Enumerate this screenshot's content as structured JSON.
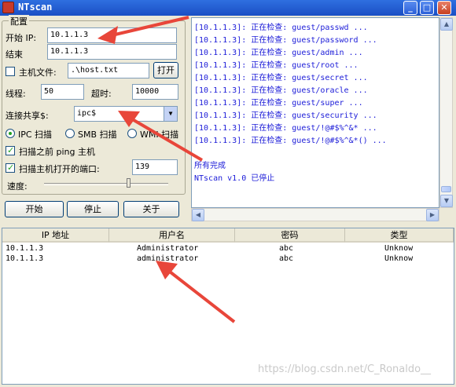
{
  "window": {
    "title": "NTscan",
    "minimize_label": "_",
    "maximize_label": "□",
    "close_label": "✕"
  },
  "config": {
    "group_title": "配置",
    "start_ip_label": "开始 IP:",
    "start_ip_value": "10.1.1.3",
    "end_label": "结束",
    "end_value": "10.1.1.3",
    "host_file_label": "主机文件:",
    "host_file_value": ".\\host.txt",
    "host_file_checked": false,
    "open_button": "打开",
    "threads_label": "线程:",
    "threads_value": "50",
    "timeout_label": "超时:",
    "timeout_value": "10000",
    "share_label": "连接共享$:",
    "share_value": "ipc$",
    "scan_modes": [
      {
        "label": "IPC 扫描",
        "selected": true
      },
      {
        "label": "SMB 扫描",
        "selected": false
      },
      {
        "label": "WMI 扫描",
        "selected": false
      }
    ],
    "ping_label": "扫描之前 ping 主机",
    "ping_checked": true,
    "port_label": "扫描主机打开的端口:",
    "port_checked": true,
    "port_value": "139",
    "speed_label": "速度:"
  },
  "buttons": {
    "start": "开始",
    "stop": "停止",
    "about": "关于"
  },
  "log": [
    "[10.1.1.3]: 正在检查: guest/passwd ...",
    "[10.1.1.3]: 正在检查: guest/password ...",
    "[10.1.1.3]: 正在检查: guest/admin ...",
    "[10.1.1.3]: 正在检查: guest/root ...",
    "[10.1.1.3]: 正在检查: guest/secret ...",
    "[10.1.1.3]: 正在检查: guest/oracle ...",
    "[10.1.1.3]: 正在检查: guest/super ...",
    "[10.1.1.3]: 正在检查: guest/security ...",
    "[10.1.1.3]: 正在检查: guest/!@#$%^&* ...",
    "[10.1.1.3]: 正在检查: guest/!@#$%^&*() ...",
    "",
    "",
    "所有完成",
    "NTscan v1.0 已停止"
  ],
  "results": {
    "columns": [
      "IP 地址",
      "用户名",
      "密码",
      "类型"
    ],
    "rows": [
      [
        "10.1.1.3",
        "Administrator",
        "abc",
        "Unknow"
      ],
      [
        "10.1.1.3",
        "administrator",
        "abc",
        "Unknow"
      ]
    ]
  },
  "annotation_color": "#e8463a",
  "watermark": "https://blog.csdn.net/C_Ronaldo__"
}
